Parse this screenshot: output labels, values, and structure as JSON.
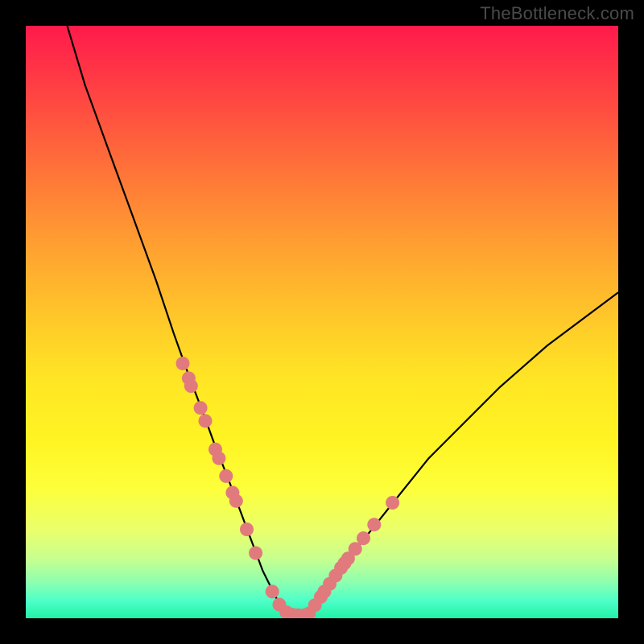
{
  "watermark": "TheBottleneck.com",
  "colors": {
    "curve": "#000000",
    "markers": "#e17a7d",
    "background_top": "#ff1a4b",
    "background_bottom": "#22f1a8"
  },
  "chart_data": {
    "type": "line",
    "title": "",
    "xlabel": "",
    "ylabel": "",
    "xlim": [
      0,
      100
    ],
    "ylim": [
      0,
      100
    ],
    "series": [
      {
        "name": "bottleneck-curve",
        "x": [
          7,
          10,
          14,
          18,
          22,
          25,
          27.5,
          30,
          32,
          34,
          35.5,
          37,
          38.5,
          40,
          42,
          43,
          45,
          47,
          49,
          51,
          53,
          56,
          60,
          64,
          68,
          73,
          80,
          88,
          96,
          100
        ],
        "values": [
          100,
          90,
          79,
          68,
          57,
          48,
          41,
          34.5,
          29,
          24,
          20,
          16,
          12,
          8,
          4,
          2,
          0.5,
          0.5,
          2.5,
          5,
          8,
          12,
          17,
          22,
          27,
          32,
          39,
          46,
          52,
          55
        ]
      }
    ],
    "markers": {
      "name": "data-points",
      "points": [
        {
          "x": 26.5,
          "y": 43
        },
        {
          "x": 27.5,
          "y": 40.5
        },
        {
          "x": 27.9,
          "y": 39.2
        },
        {
          "x": 29.5,
          "y": 35.5
        },
        {
          "x": 30.3,
          "y": 33.3
        },
        {
          "x": 32.0,
          "y": 28.5
        },
        {
          "x": 32.6,
          "y": 27
        },
        {
          "x": 33.8,
          "y": 24
        },
        {
          "x": 34.9,
          "y": 21.2
        },
        {
          "x": 35.5,
          "y": 19.8
        },
        {
          "x": 37.3,
          "y": 15
        },
        {
          "x": 38.8,
          "y": 11
        },
        {
          "x": 41.6,
          "y": 4.5
        },
        {
          "x": 42.8,
          "y": 2.3
        },
        {
          "x": 44.0,
          "y": 1.0
        },
        {
          "x": 45.0,
          "y": 0.6
        },
        {
          "x": 46.0,
          "y": 0.5
        },
        {
          "x": 47.0,
          "y": 0.5
        },
        {
          "x": 47.8,
          "y": 0.8
        },
        {
          "x": 48.8,
          "y": 2.2
        },
        {
          "x": 49.8,
          "y": 3.6
        },
        {
          "x": 50.4,
          "y": 4.5
        },
        {
          "x": 51.3,
          "y": 5.8
        },
        {
          "x": 52.3,
          "y": 7.2
        },
        {
          "x": 53.2,
          "y": 8.5
        },
        {
          "x": 53.8,
          "y": 9.3
        },
        {
          "x": 54.4,
          "y": 10.1
        },
        {
          "x": 55.6,
          "y": 11.7
        },
        {
          "x": 57.0,
          "y": 13.5
        },
        {
          "x": 58.8,
          "y": 15.8
        },
        {
          "x": 61.9,
          "y": 19.5
        }
      ]
    }
  }
}
